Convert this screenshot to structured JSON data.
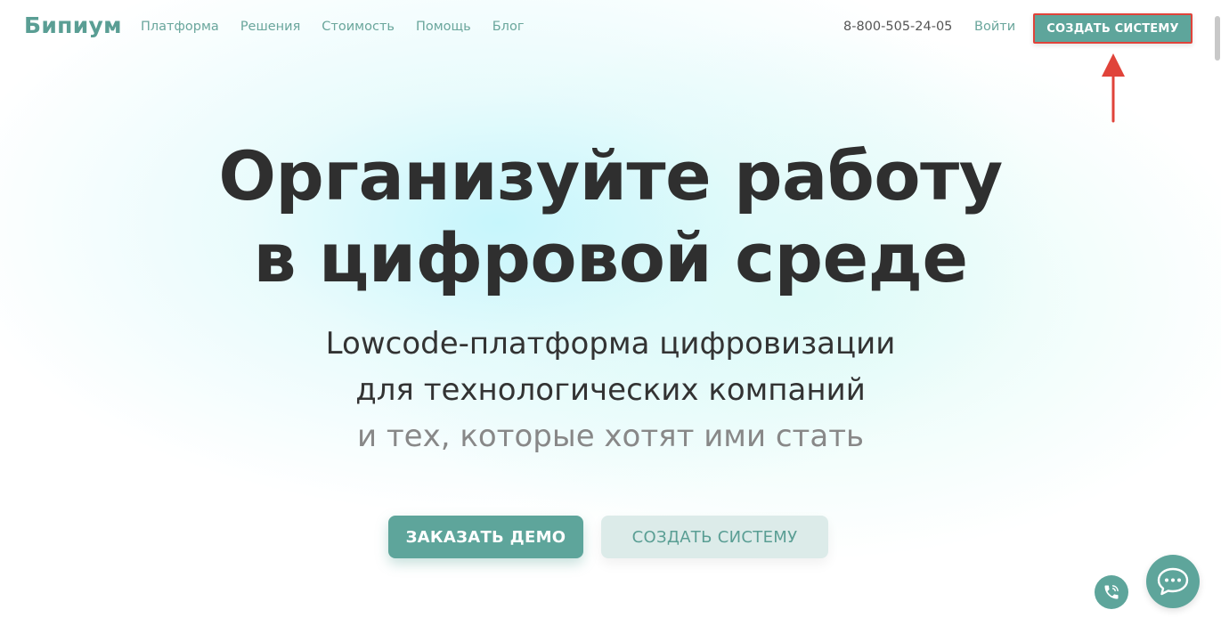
{
  "header": {
    "logo": "Бипиум",
    "nav": [
      "Платформа",
      "Решения",
      "Стоимость",
      "Помощь",
      "Блог"
    ],
    "phone": "8-800-505-24-05",
    "login_label": "Войти",
    "cta_label": "СОЗДАТЬ СИСТЕМУ"
  },
  "hero": {
    "title_line1": "Организуйте работу",
    "title_line2": "в цифровой среде",
    "subtitle_line1": "Lowcode-платформа цифровизации",
    "subtitle_line2": "для технологических компаний",
    "subtitle_line3": "и тех, которые хотят ими стать",
    "demo_button": "ЗАКАЗАТЬ ДЕМО",
    "create_button": "СОЗДАТЬ СИСТЕМУ"
  },
  "widgets": {
    "call_icon": "phone-icon",
    "chat_icon": "chat-bubble-icon"
  },
  "colors": {
    "brand": "#5ea59b",
    "highlight": "#e0433a",
    "title_text": "#2f2f2f"
  }
}
